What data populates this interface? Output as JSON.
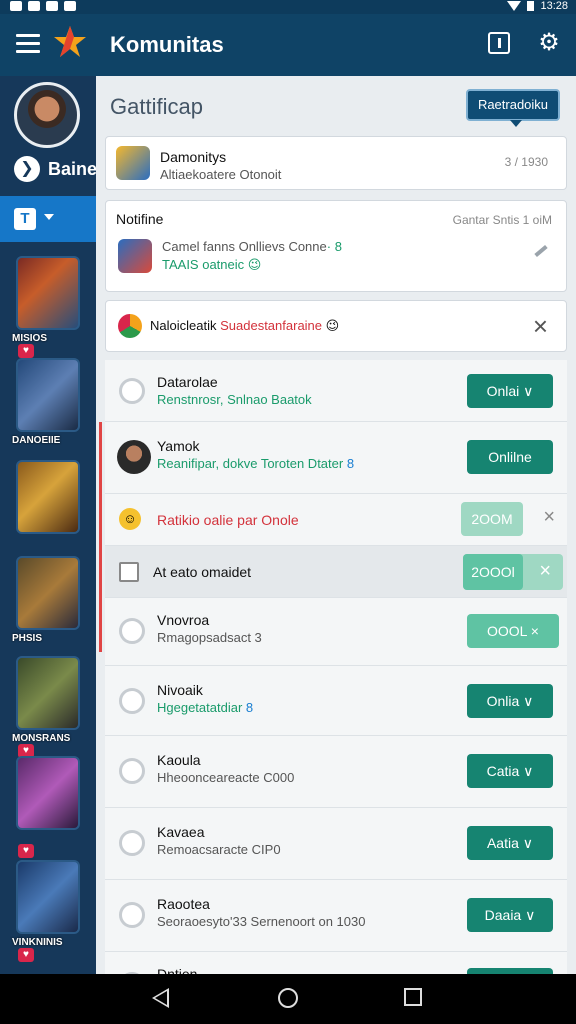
{
  "status": {
    "time": "13:28"
  },
  "appbar": {
    "title": "Komunitas",
    "icons": [
      "menu-icon",
      "star-logo-icon",
      "notification-box-icon",
      "gear-icon"
    ]
  },
  "sidebar": {
    "username": "Baine",
    "badge_glyph": "❯",
    "selector_glyph": "T",
    "games": [
      {
        "label": "MISIOS",
        "heart": "♥"
      },
      {
        "label": "DANOEIIE",
        "heart": ""
      },
      {
        "label": "",
        "heart": ""
      },
      {
        "label": "PHSIS",
        "heart": ""
      },
      {
        "label": "MONSRANS",
        "heart": "♥"
      },
      {
        "label": "",
        "heart": "♥"
      },
      {
        "label": "VINKNINIS",
        "heart": "♥"
      }
    ]
  },
  "main": {
    "section_title": "Gattificap",
    "pill_label": "Raetradoiku",
    "card1": {
      "title": "Damonitys",
      "subtitle": "Altiaekoatere Otonoit",
      "meta": "3 / 1930"
    },
    "card2": {
      "heading": "Notifine",
      "meta": "Gantar Sntis 1 oiM",
      "line1": "Camel fanns Onllievs Conne",
      "line1_icon": "· 8",
      "line2": "TAAIS oatneic",
      "line2_emoji": "😉"
    },
    "card3": {
      "text_a": "Naloicleatik",
      "text_b": "Suadestanfaraine",
      "emoji": "😉",
      "close": "×"
    },
    "rows": [
      {
        "title": "Datarolae",
        "subtitle": "Renstnrosr, Snlnao Baatok",
        "button": "Onlai ∨"
      },
      {
        "title": "Yamok",
        "subtitle": "Reanifipar, dokve Toroten Dtater",
        "subtitle_icon": "8",
        "button": "Onlilne"
      },
      {
        "title": "Ratikio oalie par Onole",
        "button": "2OOM",
        "close": "×"
      },
      {
        "title": "At eato omaidet",
        "button": "2OOOl",
        "close": "×"
      },
      {
        "title": "Vnovroa",
        "subtitle": "Rmagopsadsact 3",
        "button": "OOOL  ×"
      },
      {
        "title": "Nivoaik",
        "subtitle": "Hgegetatatdiar",
        "subtitle_icon": "8",
        "button": "Onlia ∨"
      },
      {
        "title": "Kaoula",
        "subtitle": "Hheoonceareacte C000",
        "button": "Catia ∨"
      },
      {
        "title": "Kavaea",
        "subtitle": "Remoacsaracte CIP0",
        "button": "Aatia ∨"
      },
      {
        "title": "Raootea",
        "subtitle": "Seoraoesyto'33 Sernenoort on 1030",
        "button": "Daaia ∨"
      },
      {
        "title": "Dntien",
        "subtitle": "",
        "button": ""
      }
    ]
  },
  "colors": {
    "appbar": "#0f4366",
    "accent_button": "#168471",
    "sidebar_selected": "#1677c8"
  }
}
